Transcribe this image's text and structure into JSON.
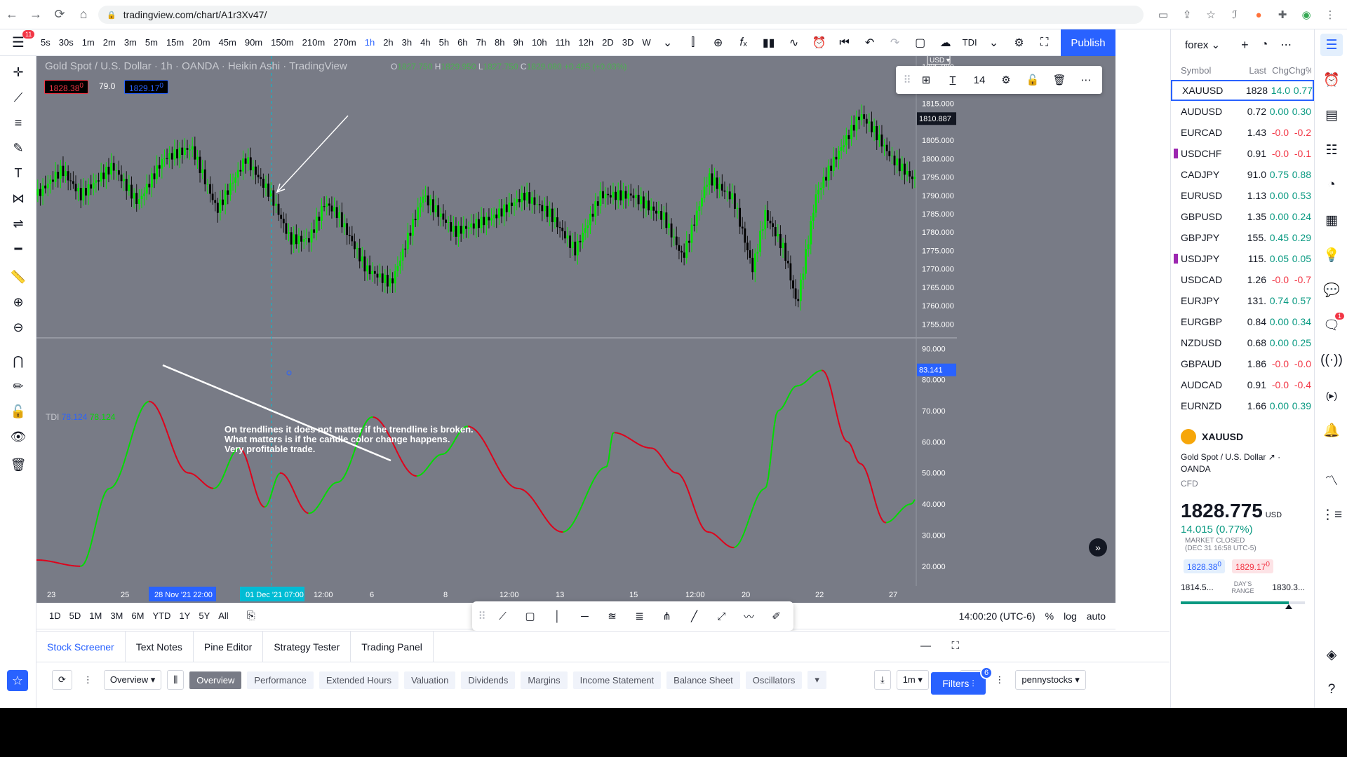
{
  "browser": {
    "url": "tradingview.com/chart/A1r3Xv47/"
  },
  "toolbar": {
    "menu_badge": "11",
    "intervals": [
      "5s",
      "30s",
      "1m",
      "2m",
      "3m",
      "5m",
      "15m",
      "20m",
      "45m",
      "90m",
      "150m",
      "210m",
      "270m",
      "1h",
      "2h",
      "3h",
      "4h",
      "5h",
      "6h",
      "7h",
      "8h",
      "9h",
      "10h",
      "11h",
      "12h",
      "2D",
      "3D",
      "W"
    ],
    "active_interval": "1h",
    "indicator_label": "TDI",
    "publish": "Publish"
  },
  "chart": {
    "legend": "Gold Spot / U.S. Dollar · 1h · OANDA · Heikin Ashi · TradingView",
    "ohlc": {
      "o": "1827.750",
      "h": "1829.950",
      "l": "1827.750",
      "c": "1829.080",
      "chg": "+0.495 (+0.03%)"
    },
    "bid": "1828.38",
    "bid_sup": "0",
    "spread": "79.0",
    "ask": "1829.17",
    "ask_sup": "0",
    "currency": "USD",
    "last_price_label": "1810.887",
    "tdi_last_label": "83.141",
    "price_ticks": [
      "1825.000",
      "1820.000",
      "1815.000",
      "1810.000",
      "1805.000",
      "1800.000",
      "1795.000",
      "1790.000",
      "1785.000",
      "1780.000",
      "1775.000",
      "1770.000",
      "1765.000",
      "1760.000",
      "1755.000"
    ],
    "tdi_ticks": [
      "90.000",
      "80.000",
      "70.000",
      "60.000",
      "50.000",
      "40.000",
      "30.000",
      "20.000"
    ],
    "float_toolbar_size": "14",
    "tdi_legend": {
      "name": "TDI",
      "v1": "78.124",
      "v2": "78.124"
    },
    "annotation": [
      "On trendlines it does not matter if the trendline is broken.",
      "What matters is if the candle color change happens.",
      "Very profitable trade."
    ],
    "time_labels": [
      "23",
      "25",
      "28 Nov '21   22:00",
      "01 Dec '21   07:00",
      "12:00",
      "6",
      "8",
      "12:00",
      "13",
      "15",
      "12:00",
      "20",
      "22",
      "27"
    ],
    "colors": {
      "bg": "#787b86",
      "up": "#00e600",
      "down": "#000000",
      "tdi_up": "#00dd00",
      "tdi_down": "#e0001a"
    }
  },
  "chart_data": {
    "type": "line",
    "title": "Gold Spot / U.S. Dollar, 1h, Heikin Ashi",
    "ylim": [
      1752,
      1826
    ],
    "x": [
      "23",
      "25",
      "28 Nov",
      "01 Dec",
      "6",
      "8",
      "13",
      "15",
      "20",
      "22",
      "27"
    ],
    "series": [
      {
        "name": "XAUUSD",
        "values": [
          1790,
          1808,
          1776,
          1790,
          1765,
          1790,
          1775,
          1792,
          1760,
          1813,
          1792,
          1810
        ]
      },
      {
        "name": "TDI",
        "values": [
          22,
          73,
          45,
          58,
          39,
          50,
          37,
          68,
          49,
          65,
          31,
          58,
          25,
          83,
          30,
          80,
          53
        ]
      }
    ]
  },
  "rangebar": {
    "ranges": [
      "1D",
      "5D",
      "1M",
      "3M",
      "6M",
      "YTD",
      "1Y",
      "5Y",
      "All"
    ],
    "time": "14:00:20 (UTC-6)",
    "pct": "%",
    "log": "log",
    "auto": "auto"
  },
  "panel": {
    "tabs": [
      "Stock Screener",
      "Text Notes",
      "Pine Editor",
      "Strategy Tester",
      "Trading Panel"
    ],
    "screener_view": "Overview",
    "chips": [
      "Overview",
      "Performance",
      "Extended Hours",
      "Valuation",
      "Dividends",
      "Margins",
      "Income Statement",
      "Balance Sheet",
      "Oscillators"
    ],
    "interval": "1m",
    "watchlist": "pennystocks",
    "filters": "Filters",
    "filters_badge": "6"
  },
  "watchlist": {
    "name": "forex",
    "columns": [
      "Symbol",
      "Last",
      "Chg",
      "Chg%"
    ],
    "rows": [
      {
        "sym": "XAUUSD",
        "last": "1828",
        "chg": "14.0",
        "chgp": "0.77",
        "dir": "pos",
        "flag": false
      },
      {
        "sym": "AUDUSD",
        "last": "0.72",
        "chg": "0.00",
        "chgp": "0.30",
        "dir": "pos",
        "flag": false
      },
      {
        "sym": "EURCAD",
        "last": "1.43",
        "chg": "-0.0",
        "chgp": "-0.2",
        "dir": "neg",
        "flag": false
      },
      {
        "sym": "USDCHF",
        "last": "0.91",
        "chg": "-0.0",
        "chgp": "-0.1",
        "dir": "neg",
        "flag": true
      },
      {
        "sym": "CADJPY",
        "last": "91.0",
        "chg": "0.75",
        "chgp": "0.88",
        "dir": "pos",
        "flag": false
      },
      {
        "sym": "EURUSD",
        "last": "1.13",
        "chg": "0.00",
        "chgp": "0.53",
        "dir": "pos",
        "flag": false
      },
      {
        "sym": "GBPUSD",
        "last": "1.35",
        "chg": "0.00",
        "chgp": "0.24",
        "dir": "pos",
        "flag": false
      },
      {
        "sym": "GBPJPY",
        "last": "155.",
        "chg": "0.45",
        "chgp": "0.29",
        "dir": "pos",
        "flag": false
      },
      {
        "sym": "USDJPY",
        "last": "115.",
        "chg": "0.05",
        "chgp": "0.05",
        "dir": "pos",
        "flag": true
      },
      {
        "sym": "USDCAD",
        "last": "1.26",
        "chg": "-0.0",
        "chgp": "-0.7",
        "dir": "neg",
        "flag": false
      },
      {
        "sym": "EURJPY",
        "last": "131.",
        "chg": "0.74",
        "chgp": "0.57",
        "dir": "pos",
        "flag": false
      },
      {
        "sym": "EURGBP",
        "last": "0.84",
        "chg": "0.00",
        "chgp": "0.34",
        "dir": "pos",
        "flag": false
      },
      {
        "sym": "NZDUSD",
        "last": "0.68",
        "chg": "0.00",
        "chgp": "0.25",
        "dir": "pos",
        "flag": false
      },
      {
        "sym": "GBPAUD",
        "last": "1.86",
        "chg": "-0.0",
        "chgp": "-0.0",
        "dir": "neg",
        "flag": false
      },
      {
        "sym": "AUDCAD",
        "last": "0.91",
        "chg": "-0.0",
        "chgp": "-0.4",
        "dir": "neg",
        "flag": false
      },
      {
        "sym": "EURNZD",
        "last": "1.66",
        "chg": "0.00",
        "chgp": "0.39",
        "dir": "pos",
        "flag": false
      }
    ]
  },
  "detail": {
    "symbol": "XAUUSD",
    "name": "Gold Spot / U.S. Dollar",
    "exchange": "OANDA",
    "type": "CFD",
    "price": "1828.775",
    "currency": "USD",
    "change": "14.015 (0.77%)",
    "status": "MARKET CLOSED",
    "status_time": "(DEC 31 16:58 UTC-5)",
    "bid": "1828.38",
    "bid_sup": "0",
    "ask": "1829.17",
    "ask_sup": "0",
    "range_low": "1814.5...",
    "range_label": "DAY'S RANGE",
    "range_high": "1830.3...",
    "range_position": 0.87
  },
  "rightbar": {
    "notif_badge": "1"
  }
}
